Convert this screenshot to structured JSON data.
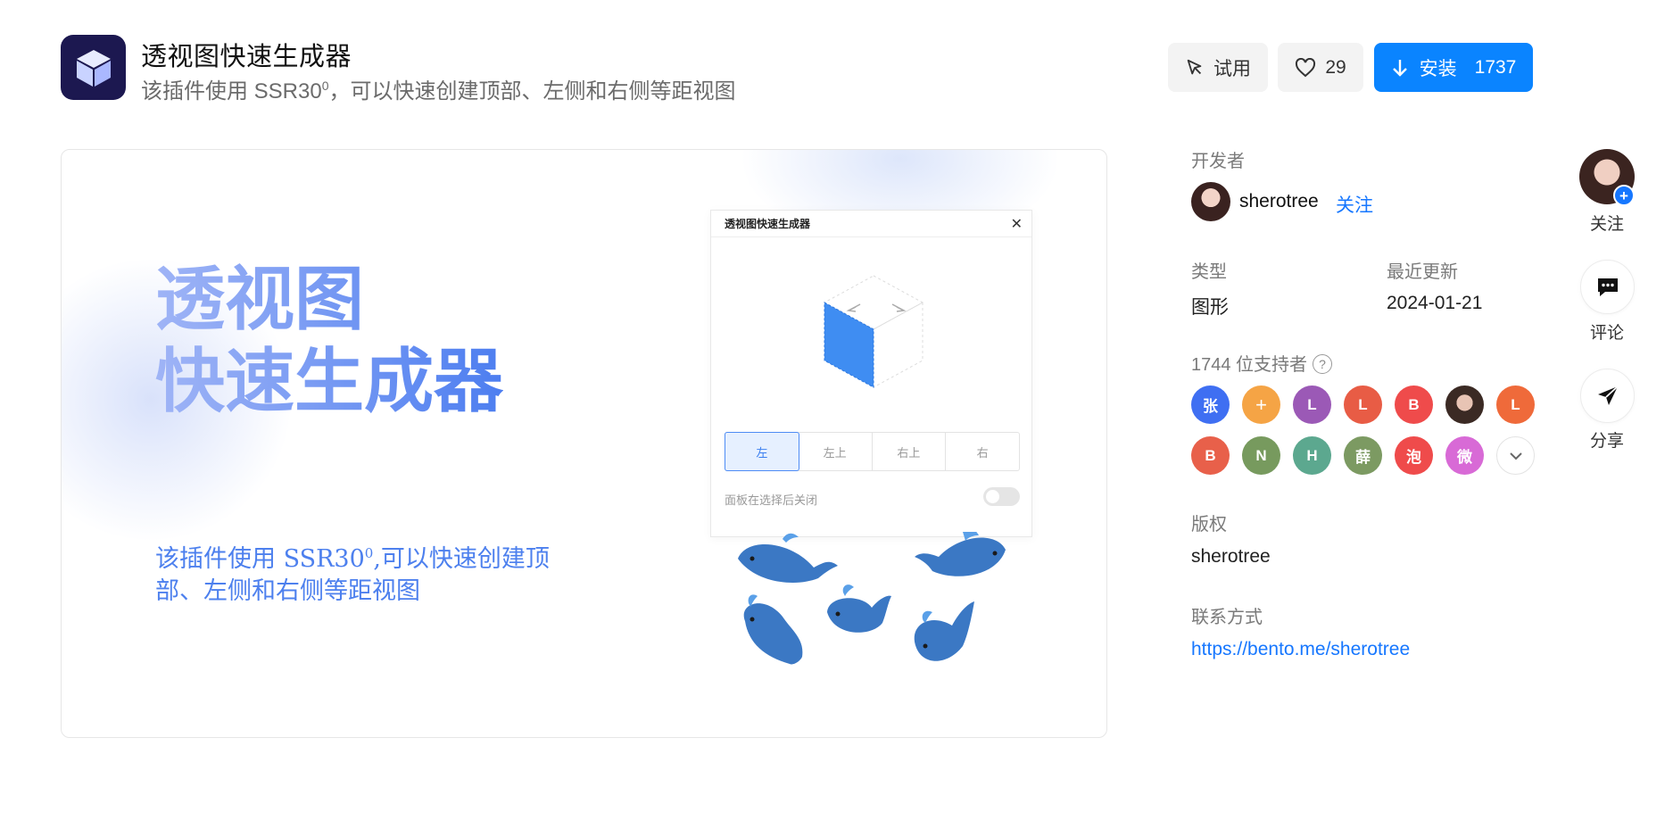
{
  "header": {
    "icon": "cube-icon",
    "title": "透视图快速生成器",
    "subtitle_prefix": "该插件使用 SSR30",
    "subtitle_sup": "0",
    "subtitle_suffix": "，可以快速创建顶部、左侧和右侧等距视图"
  },
  "actions": {
    "try_label": "试用",
    "like_count": "29",
    "install_label": "安装",
    "install_count": "1737",
    "accent": "#0a84ff"
  },
  "preview": {
    "hero_line1": "透视图",
    "hero_line2": "快速生成器",
    "desc_prefix": "该插件使用 SSR30",
    "desc_sup": "0",
    "desc_suffix": ",可以快速创建顶部、左侧和右侧等距视图",
    "mock": {
      "title": "透视图快速生成器",
      "segments": [
        "左",
        "左上",
        "右上",
        "右"
      ],
      "active_segment": "左",
      "toggle_label": "面板在选择后关闭",
      "toggle_on": false
    }
  },
  "sidebar": {
    "developer_label": "开发者",
    "developer_name": "sherotree",
    "follow_label": "关注",
    "type_label": "类型",
    "type_value": "图形",
    "updated_label": "最近更新",
    "updated_value": "2024-01-21",
    "supporters_label": "1744 位支持者",
    "supporters": [
      {
        "text": "张",
        "color": "#3f6ff2"
      },
      {
        "text": "+",
        "color": "#f5a445"
      },
      {
        "text": "L",
        "color": "#9b59b6"
      },
      {
        "text": "L",
        "color": "#e85c45"
      },
      {
        "text": "B",
        "color": "#ef4b4b"
      },
      {
        "text": "",
        "color": "#3b2a24"
      },
      {
        "text": "L",
        "color": "#ef6a3a"
      },
      {
        "text": "B",
        "color": "#e8604a"
      },
      {
        "text": "N",
        "color": "#779a5e"
      },
      {
        "text": "H",
        "color": "#5ca88f"
      },
      {
        "text": "薛",
        "color": "#7c9a62"
      },
      {
        "text": "泡",
        "color": "#ef4b4b"
      },
      {
        "text": "微",
        "color": "#d86ad6"
      }
    ],
    "copyright_label": "版权",
    "copyright_value": "sherotree",
    "contact_label": "联系方式",
    "contact_value": "https://bento.me/sherotree"
  },
  "rail": {
    "follow_label": "关注",
    "comment_label": "评论",
    "share_label": "分享"
  }
}
